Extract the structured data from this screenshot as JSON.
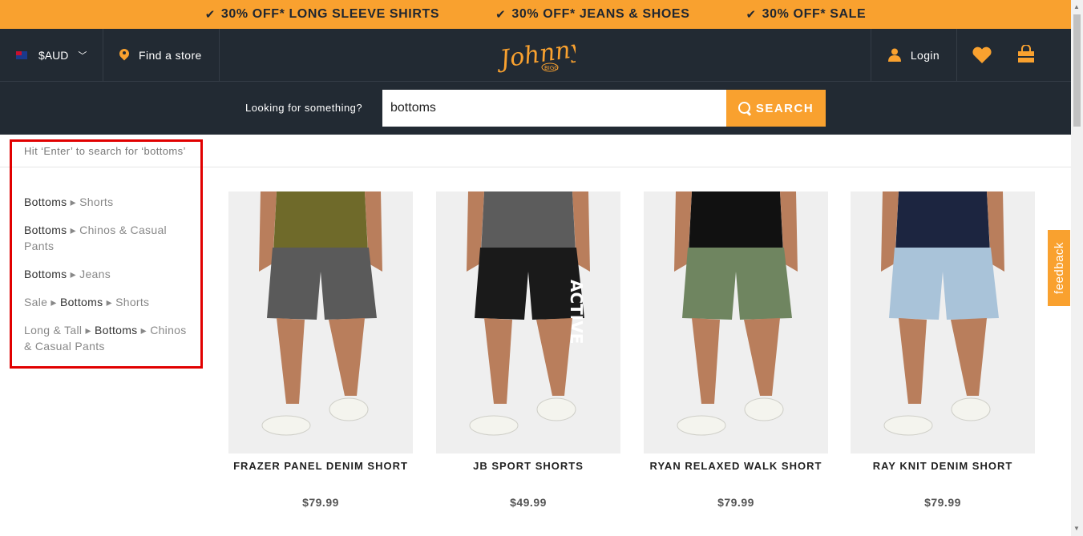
{
  "promo": [
    {
      "text": "30% OFF* LONG SLEEVE SHIRTS"
    },
    {
      "text": "30% OFF* JEANS & SHOES"
    },
    {
      "text": "30% OFF* SALE"
    }
  ],
  "header": {
    "currency": "$AUD",
    "find_store": "Find a store",
    "logo_text": "Johnny",
    "logo_sub": "BIGG",
    "login": "Login"
  },
  "search": {
    "label": "Looking for something?",
    "value": "bottoms",
    "button": "SEARCH",
    "hint": "Hit ‘Enter’ to search for ‘bottoms’"
  },
  "suggestions": [
    {
      "parts": [
        {
          "t": "Bottoms",
          "b": true
        },
        {
          "t": " ▸ Shorts",
          "b": false
        }
      ]
    },
    {
      "parts": [
        {
          "t": "Bottoms",
          "b": true
        },
        {
          "t": " ▸ Chinos & Casual Pants",
          "b": false
        }
      ]
    },
    {
      "parts": [
        {
          "t": "Bottoms",
          "b": true
        },
        {
          "t": " ▸ Jeans",
          "b": false
        }
      ]
    },
    {
      "parts": [
        {
          "t": "Sale ▸ ",
          "b": false
        },
        {
          "t": "Bottoms",
          "b": true
        },
        {
          "t": " ▸ Shorts",
          "b": false
        }
      ]
    },
    {
      "parts": [
        {
          "t": "Long & Tall ▸ ",
          "b": false
        },
        {
          "t": "Bottoms",
          "b": true
        },
        {
          "t": " ▸ Chinos & Casual Pants",
          "b": false
        }
      ]
    }
  ],
  "products": [
    {
      "name": "FRAZER PANEL DENIM SHORT",
      "price": "$79.99",
      "shirt": "#6f6a2a",
      "shorts": "#5a5a5a"
    },
    {
      "name": "JB SPORT SHORTS",
      "price": "$49.99",
      "shirt": "#5c5c5c",
      "shorts": "#1a1a1a",
      "shorts_text": "ACTIVE"
    },
    {
      "name": "RYAN RELAXED WALK SHORT",
      "price": "$79.99",
      "shirt": "#111111",
      "shorts": "#6f8560"
    },
    {
      "name": "RAY KNIT DENIM SHORT",
      "price": "$79.99",
      "shirt": "#1c2540",
      "shorts": "#a9c3d9"
    }
  ],
  "feedback": "feedback",
  "colors": {
    "accent": "#f9a12f",
    "header": "#222a33",
    "highlight": "#e10000"
  }
}
